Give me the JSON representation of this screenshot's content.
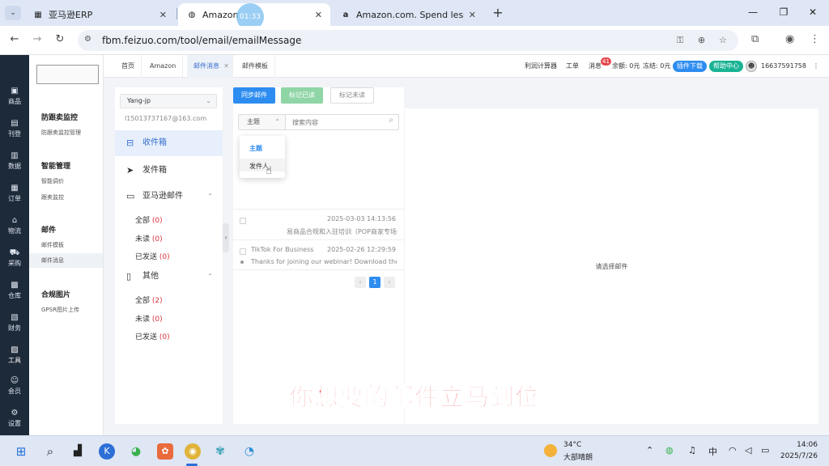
{
  "browser": {
    "tabs": [
      {
        "title": "亚马逊ERP",
        "icon": "erp-favicon"
      },
      {
        "title": "Amazon",
        "icon": "globe-icon"
      },
      {
        "title": "Amazon.com. Spend less. Sm",
        "icon": "amazon-favicon"
      }
    ],
    "timer_overlay": "01:33",
    "url": "fbm.feizuo.com/tool/email/emailMessage"
  },
  "rail": [
    {
      "label": "商品",
      "icon": "box-icon"
    },
    {
      "label": "刊登",
      "icon": "publish-icon"
    },
    {
      "label": "数据",
      "icon": "data-icon"
    },
    {
      "label": "订单",
      "icon": "order-icon"
    },
    {
      "label": "物流",
      "icon": "logistics-icon"
    },
    {
      "label": "采购",
      "icon": "cart-icon"
    },
    {
      "label": "仓库",
      "icon": "warehouse-icon"
    },
    {
      "label": "财务",
      "icon": "finance-icon"
    },
    {
      "label": "工具",
      "icon": "tools-icon"
    },
    {
      "label": "会员",
      "icon": "member-icon"
    },
    {
      "label": "设置",
      "icon": "settings-icon"
    }
  ],
  "side_menu": {
    "groups": [
      {
        "title": "防跟卖监控",
        "items": [
          "防跟卖监控管理"
        ]
      },
      {
        "title": "智能管理",
        "items": [
          "智能调价",
          "跟卖监控"
        ]
      },
      {
        "title": "邮件",
        "items": [
          "邮件模板",
          "邮件消息"
        ]
      },
      {
        "title": "合规图片",
        "items": [
          "GPSR图片上传"
        ]
      }
    ],
    "active_item": "邮件消息"
  },
  "topnav": {
    "tabs": [
      {
        "label": "首页",
        "closable": false
      },
      {
        "label": "Amazon",
        "closable": false
      },
      {
        "label": "邮件消息",
        "closable": true
      },
      {
        "label": "邮件模板",
        "closable": false
      }
    ],
    "profit_calc": "利润计算器",
    "work_order": "工单",
    "messages": "消息",
    "message_count": "41",
    "balance": "余额: 0元",
    "frozen": "冻结: 0元",
    "plugin_download": "插件下载",
    "help_center": "帮助中心",
    "phone": "16637591758",
    "more": "⋮"
  },
  "mail": {
    "account": "Yang-jp",
    "account_email": "l15013737167@163.com",
    "folders": {
      "inbox": "收件箱",
      "sent": "发件箱",
      "amazon_mail": "亚马逊邮件",
      "other": "其他"
    },
    "amazon_sub": [
      {
        "label": "全部",
        "count": "(0)"
      },
      {
        "label": "未读",
        "count": "(0)"
      },
      {
        "label": "已发送",
        "count": "(0)"
      }
    ],
    "other_sub": [
      {
        "label": "全部",
        "count": "(2)"
      },
      {
        "label": "未读",
        "count": "(0)"
      },
      {
        "label": "已发送",
        "count": "(0)"
      }
    ]
  },
  "toolbar": {
    "sync": "同步邮件",
    "mark_read": "标记已读",
    "mark_unread": "标记未读"
  },
  "search": {
    "type_value": "主题",
    "placeholder": "搜索内容",
    "options": [
      "主题",
      "发件人"
    ]
  },
  "mails": [
    {
      "sender": "",
      "date": "2025-03-03 14:13:56",
      "subject": "易商品合规和入驻培训（POP商家专场）"
    },
    {
      "sender": "TikTok For Business",
      "date": "2025-02-26 12:29:59",
      "subject": "Thanks for joining our webinar! Download the..."
    }
  ],
  "pager": {
    "prev": "‹",
    "current": "1",
    "next": "›"
  },
  "preview": {
    "empty_text": "请选择邮件"
  },
  "subtitle_overlay": "你想要的邮件立马到位",
  "taskbar": {
    "temperature": "34°C",
    "weather": "大部晴朗",
    "ime": "中",
    "time": "14:06",
    "date": "2025/7/26"
  }
}
